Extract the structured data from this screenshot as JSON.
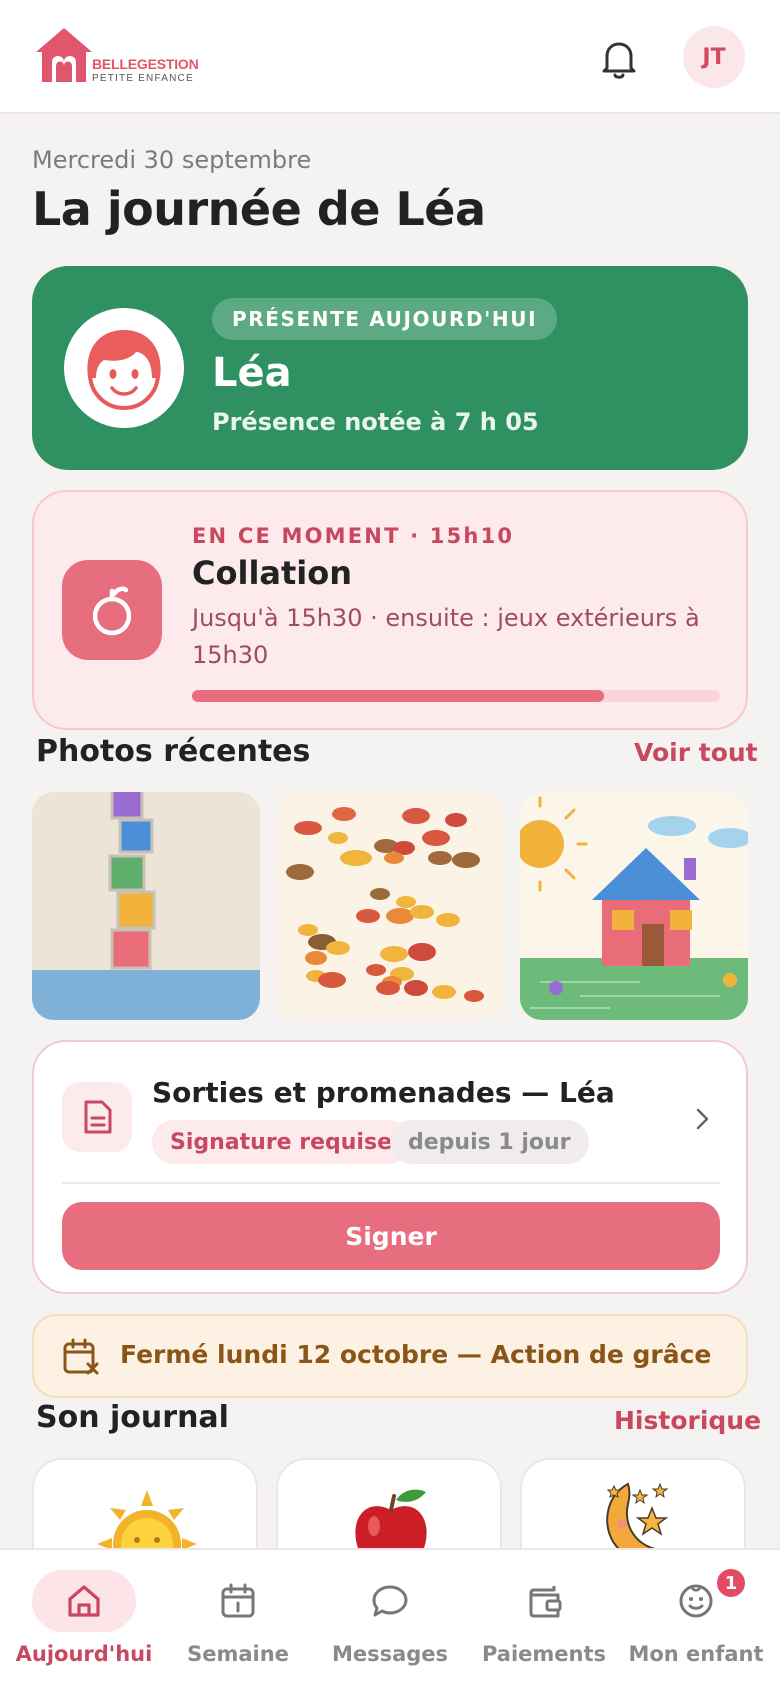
{
  "header": {
    "logo": {
      "line1": "BELLEGESTION",
      "line2": "PETITE ENFANCE"
    },
    "avatar_initials": "JT"
  },
  "page": {
    "date": "Mercredi 30 septembre",
    "title": "La journée de Léa"
  },
  "presence": {
    "status": "PRÉSENTE AUJOURD'HUI",
    "name": "Léa",
    "note": "Présence notée à 7 h 05",
    "color": "#2f9162"
  },
  "moment": {
    "kicker": "EN CE MOMENT · 15h10",
    "title": "Collation",
    "description": "Jusqu'à 15h30 · ensuite : jeux extérieurs à 15h30",
    "progress": 0.78,
    "icon": "apple-icon"
  },
  "photos": {
    "title": "Photos récentes",
    "link": "Voir tout",
    "items": [
      "stacked-blocks-drawing",
      "autumn-leaves-drawing",
      "house-sun-drawing"
    ]
  },
  "document": {
    "title": "Sorties et promenades — Léa",
    "badge_status": "Signature requise",
    "badge_time": "depuis 1 jour",
    "button": "Signer",
    "icon": "document-icon"
  },
  "closure": {
    "text": "Fermé lundi 12 octobre — Action de grâce",
    "icon": "calendar-x-icon"
  },
  "journal": {
    "title": "Son journal",
    "link": "Historique",
    "items": [
      "sun-icon",
      "apple-icon",
      "moon-stars-icon"
    ]
  },
  "tabs": [
    {
      "label": "Aujourd'hui",
      "icon": "home-icon",
      "active": true
    },
    {
      "label": "Semaine",
      "icon": "calendar-icon",
      "active": false
    },
    {
      "label": "Messages",
      "icon": "chat-bubble-icon",
      "active": false
    },
    {
      "label": "Paiements",
      "icon": "wallet-icon",
      "active": false
    },
    {
      "label": "Mon enfant",
      "icon": "smiley-icon",
      "active": false,
      "badge": "1"
    }
  ],
  "colors": {
    "accent": "#e76e7e",
    "accent_text": "#c8485f",
    "background": "#f5f3f1"
  }
}
